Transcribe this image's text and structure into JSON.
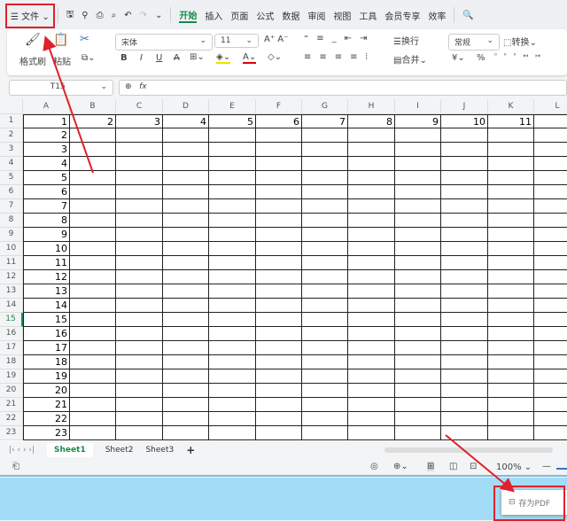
{
  "menubar": {
    "file": "文件",
    "tabs": [
      "开始",
      "插入",
      "页面",
      "公式",
      "数据",
      "审阅",
      "视图",
      "工具",
      "会员专享",
      "效率"
    ],
    "active": "开始"
  },
  "ribbon": {
    "format_painter": "格式刷",
    "paste": "粘贴",
    "font": "宋体",
    "size": "11",
    "wrap": "换行",
    "merge": "合并",
    "number_format": "常规",
    "convert": "转换",
    "currency": "¥",
    "percent": "%"
  },
  "formula": {
    "cell_ref": "T15",
    "fx": "fx"
  },
  "grid": {
    "columns": [
      "A",
      "B",
      "C",
      "D",
      "E",
      "F",
      "G",
      "H",
      "I",
      "J",
      "K",
      "L"
    ],
    "rows": [
      "1",
      "2",
      "3",
      "4",
      "5",
      "6",
      "7",
      "8",
      "9",
      "10",
      "11",
      "12",
      "13",
      "14",
      "15",
      "16",
      "17",
      "18",
      "19",
      "20",
      "21",
      "22",
      "23"
    ],
    "row1_values": [
      "1",
      "2",
      "3",
      "4",
      "5",
      "6",
      "7",
      "8",
      "9",
      "10",
      "11"
    ],
    "colA_values": [
      "1",
      "2",
      "3",
      "4",
      "5",
      "6",
      "7",
      "8",
      "9",
      "10",
      "11",
      "12",
      "13",
      "14",
      "15",
      "16",
      "17",
      "18",
      "19",
      "20",
      "21",
      "22",
      "23"
    ],
    "active_row": "15"
  },
  "sheets": {
    "tabs": [
      "Sheet1",
      "Sheet2",
      "Sheet3"
    ],
    "active": "Sheet1",
    "add": "+"
  },
  "status": {
    "zoom": "100%"
  },
  "popup": {
    "save_pdf": "存为PDF"
  },
  "colors": {
    "accent": "#1a8a4b",
    "annotation": "#e0202a",
    "background": "#a2dcf7"
  }
}
